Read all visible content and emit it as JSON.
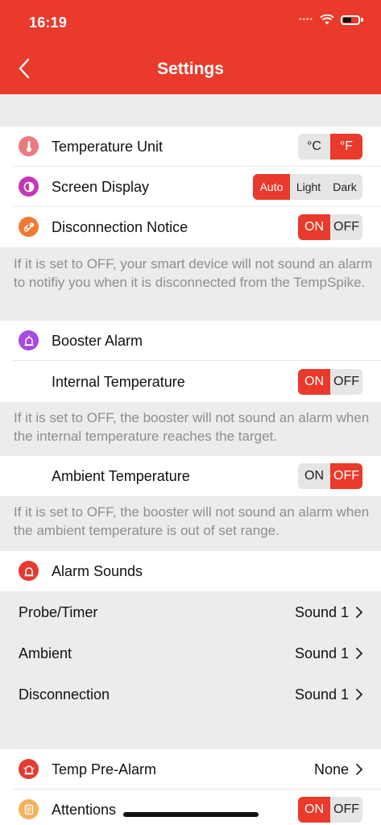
{
  "status": {
    "time": "16:19"
  },
  "header": {
    "title": "Settings"
  },
  "temperature_unit": {
    "label": "Temperature Unit",
    "options": [
      "°C",
      "°F"
    ],
    "selected": "°F"
  },
  "screen_display": {
    "label": "Screen Display",
    "options": [
      "Auto",
      "Light",
      "Dark"
    ],
    "selected": "Auto"
  },
  "disconnection_notice": {
    "label": "Disconnection Notice",
    "on": "ON",
    "off": "OFF",
    "selected": "ON",
    "note": "If it is set to OFF, your smart device will not sound an alarm to notifiy you when it is disconnected from the TempSpike."
  },
  "booster_alarm": {
    "label": "Booster Alarm"
  },
  "internal_temperature": {
    "label": "Internal Temperature",
    "on": "ON",
    "off": "OFF",
    "selected": "ON",
    "note": "If it is set to OFF, the booster will not sound an alarm when the internal temperature reaches the target."
  },
  "ambient_temperature": {
    "label": "Ambient Temperature",
    "on": "ON",
    "off": "OFF",
    "selected": "OFF",
    "note": "If it is set to OFF, the booster will not sound an alarm when the ambient temperature is out of set range."
  },
  "alarm_sounds": {
    "label": "Alarm Sounds",
    "items": [
      {
        "label": "Probe/Timer",
        "value": "Sound 1"
      },
      {
        "label": "Ambient",
        "value": "Sound 1"
      },
      {
        "label": "Disconnection",
        "value": "Sound 1"
      }
    ]
  },
  "temp_pre_alarm": {
    "label": "Temp Pre-Alarm",
    "value": "None"
  },
  "attentions": {
    "label": "Attentions",
    "on": "ON",
    "off": "OFF",
    "selected": "ON"
  },
  "colors": {
    "brand": "#e93a2b",
    "pink_icon": "#ec7b7f",
    "magenta_icon": "#c438b6",
    "orange_icon": "#f07a35",
    "purple_icon": "#a64ae0",
    "red_icon": "#e33b32",
    "yellow_icon": "#f4b15a"
  }
}
